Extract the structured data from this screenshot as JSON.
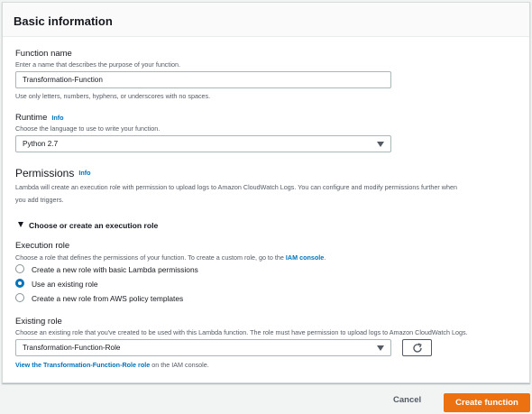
{
  "panel": {
    "title": "Basic information"
  },
  "function_name": {
    "label": "Function name",
    "description": "Enter a name that describes the purpose of your function.",
    "value": "Transformation-Function",
    "hint": "Use only letters, numbers, hyphens, or underscores with no spaces."
  },
  "runtime": {
    "label": "Runtime",
    "info": "Info",
    "description": "Choose the language to use to write your function.",
    "selected": "Python 2.7"
  },
  "permissions": {
    "title": "Permissions",
    "info": "Info",
    "description_line1": "Lambda will create an execution role with permission to upload logs to Amazon CloudWatch Logs. You can configure and modify permissions further when",
    "description_line2": "you add triggers.",
    "expander_label": "Choose or create an execution role"
  },
  "execution_role": {
    "label": "Execution role",
    "description_prefix": "Choose a role that defines the permissions of your function. To create a custom role, go to the ",
    "description_link": "IAM console",
    "description_suffix": ".",
    "options": [
      {
        "label": "Create a new role with basic Lambda permissions",
        "checked": false
      },
      {
        "label": "Use an existing role",
        "checked": true
      },
      {
        "label": "Create a new role from AWS policy templates",
        "checked": false
      }
    ]
  },
  "existing_role": {
    "label": "Existing role",
    "description": "Choose an existing role that you've created to be used with this Lambda function. The role must have permission to upload logs to Amazon CloudWatch Logs.",
    "selected": "Transformation-Function-Role",
    "view_link": "View the Transformation-Function-Role role",
    "view_suffix": " on the IAM console."
  },
  "footer": {
    "cancel_label": "Cancel",
    "create_label": "Create function"
  },
  "colors": {
    "accent": "#0073bb",
    "primary_button": "#ec7211"
  },
  "icons": {
    "refresh": "refresh-icon",
    "caret": "caret-down-icon",
    "expander": "caret-expanded-icon"
  }
}
